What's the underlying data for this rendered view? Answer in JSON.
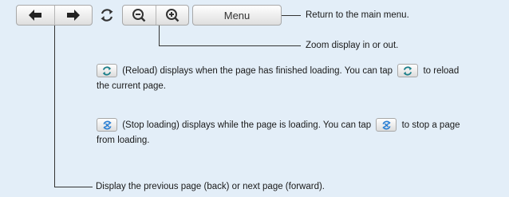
{
  "toolbar": {
    "back_icon": "arrow-left-icon",
    "forward_icon": "arrow-right-icon",
    "reload_icon": "reload-icon",
    "zoom_out_icon": "zoom-out-icon",
    "zoom_in_icon": "zoom-in-icon",
    "menu_label": "Menu"
  },
  "callouts": {
    "menu": "Return to the main menu.",
    "zoom": "Zoom display in or out.",
    "back_forward": "Display the previous page (back) or next page (forward)."
  },
  "reload_info": {
    "part1": "(Reload) displays when the page has finished loading. You can tap",
    "part2": "to reload",
    "part3": "the current page."
  },
  "stop_info": {
    "part1": "(Stop loading) displays while the page is loading. You can tap",
    "part2": "to stop a page",
    "part3": "from loading."
  },
  "colors": {
    "background": "#e3eef8",
    "reload_icon": "#1c7f8a",
    "stop_icon": "#2a7fd4"
  }
}
